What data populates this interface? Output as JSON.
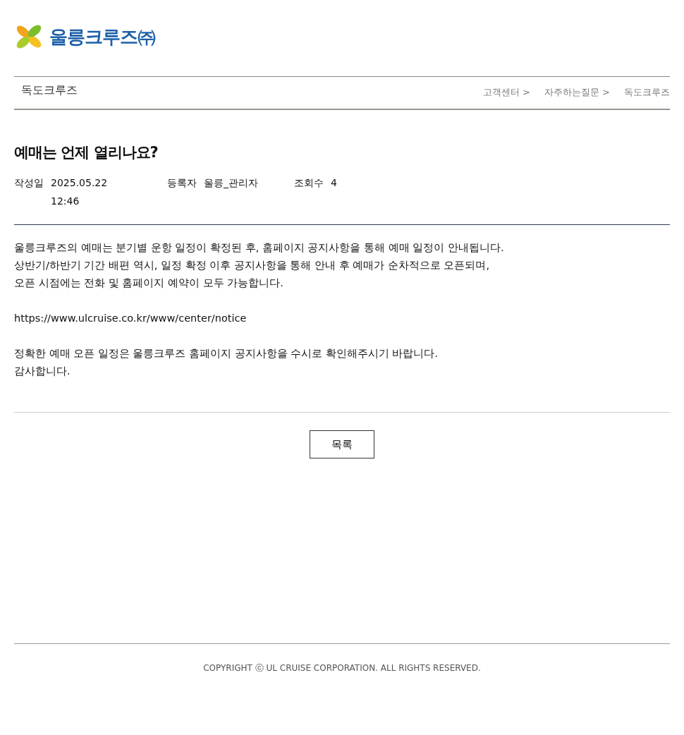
{
  "logo": {
    "text": "울릉크루즈㈜"
  },
  "subheader": {
    "title": "독도크루즈",
    "breadcrumb": [
      "고객센터 >",
      "자주하는질문 >",
      "독도크루즈"
    ]
  },
  "post": {
    "title": "예매는 언제 열리나요?",
    "meta": [
      {
        "label": "작성일",
        "value": "2025.05.22 12:46"
      },
      {
        "label": "등록자",
        "value": "울릉_관리자"
      },
      {
        "label": "조회수",
        "value": "4"
      }
    ],
    "paragraphs": [
      [
        "울릉크루즈의 예매는 분기별 운항 일정이 확정된 후, 홈페이지 공지사항을 통해 예매 일정이 안내됩니다.",
        "상반기/하반기 기간 배편 역시, 일정 확정 이후 공지사항을 통해 안내 후 예매가 순차적으로 오픈되며,",
        "오픈 시점에는 전화 및 홈페이지 예약이 모두 가능합니다."
      ],
      [
        "https://www.ulcruise.co.kr/www/center/notice"
      ],
      [
        "정확한 예매 오픈 일정은 울릉크루즈 홈페이지 공지사항을 수시로 확인해주시기 바랍니다.",
        "감사합니다."
      ]
    ]
  },
  "list_button": "목록",
  "footer": "COPYRIGHT ⓒ UL CRUISE CORPORATION. ALL RIGHTS RESERVED."
}
